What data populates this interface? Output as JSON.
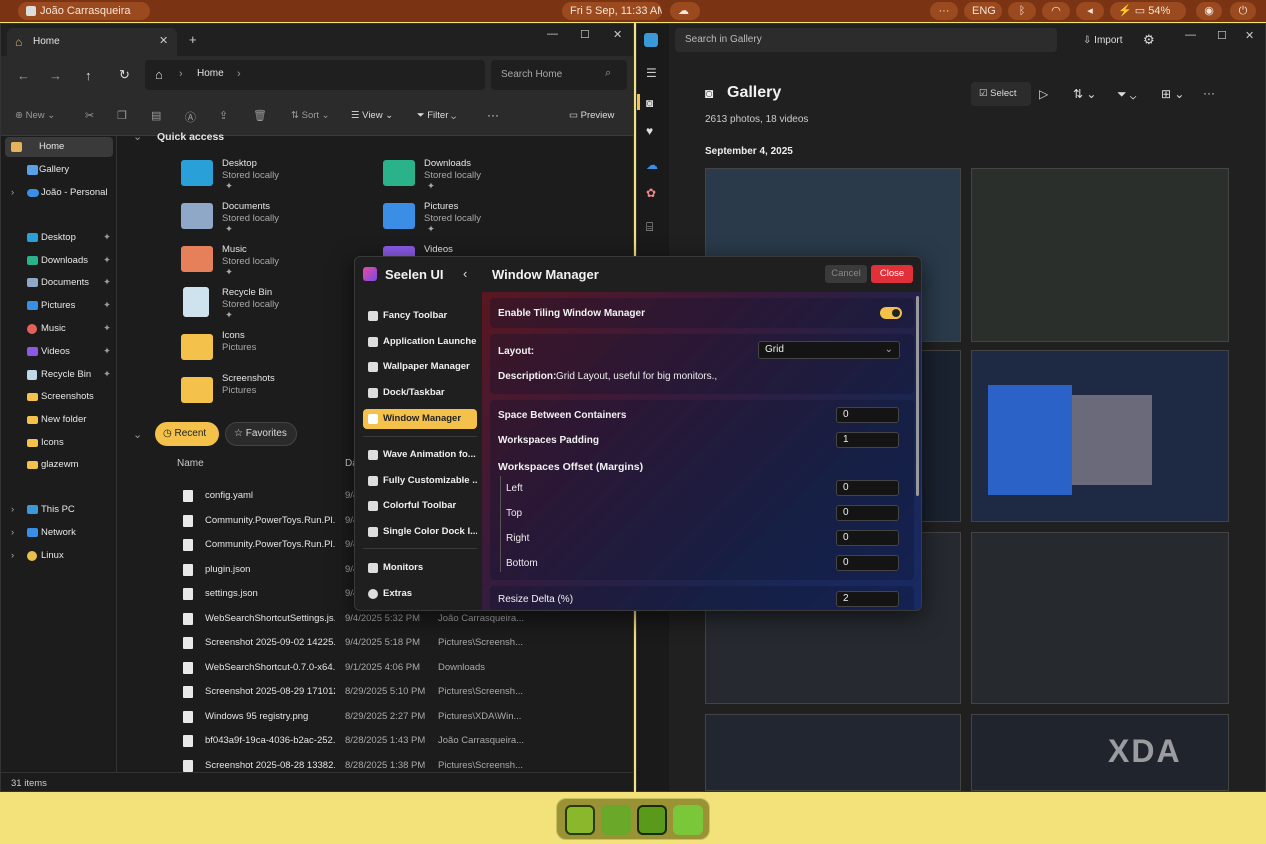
{
  "topbar": {
    "user": "João Carrasqueira",
    "datetime": "Fri 5 Sep, 11:33 AM",
    "more": "···",
    "lang": "ENG",
    "battery": "54%"
  },
  "explorer": {
    "tab_title": "Home",
    "breadcrumb": "Home",
    "search_placeholder": "Search Home",
    "cmd": {
      "new": "New",
      "sort": "Sort",
      "view": "View",
      "filter": "Filter",
      "more": "···",
      "preview": "Preview"
    },
    "sidebar": [
      {
        "label": "Home"
      },
      {
        "label": "Gallery"
      },
      {
        "label": "João - Personal"
      },
      {
        "label": "Desktop"
      },
      {
        "label": "Downloads"
      },
      {
        "label": "Documents"
      },
      {
        "label": "Pictures"
      },
      {
        "label": "Music"
      },
      {
        "label": "Videos"
      },
      {
        "label": "Recycle Bin"
      },
      {
        "label": "Screenshots"
      },
      {
        "label": "New folder"
      },
      {
        "label": "Icons"
      },
      {
        "label": "glazewm"
      },
      {
        "label": "This PC"
      },
      {
        "label": "Network"
      },
      {
        "label": "Linux"
      }
    ],
    "quick_access_title": "Quick access",
    "quick_access": [
      {
        "name": "Desktop",
        "sub": "Stored locally"
      },
      {
        "name": "Downloads",
        "sub": "Stored locally"
      },
      {
        "name": "Documents",
        "sub": "Stored locally"
      },
      {
        "name": "Pictures",
        "sub": "Stored locally"
      },
      {
        "name": "Music",
        "sub": "Stored locally"
      },
      {
        "name": "Videos",
        "sub": ""
      },
      {
        "name": "Recycle Bin",
        "sub": "Stored locally"
      },
      {
        "name": "Icons",
        "sub": "Pictures"
      },
      {
        "name": "Screenshots",
        "sub": "Pictures"
      }
    ],
    "tabs": {
      "recent": "Recent",
      "favorites": "Favorites"
    },
    "columns": {
      "name": "Name",
      "date": "Da"
    },
    "files": [
      {
        "name": "config.yaml",
        "date": "9/4",
        "loc": ""
      },
      {
        "name": "Community.PowerToys.Run.Pl...",
        "date": "9/4",
        "loc": ""
      },
      {
        "name": "Community.PowerToys.Run.Pl...",
        "date": "9/4",
        "loc": ""
      },
      {
        "name": "plugin.json",
        "date": "9/4",
        "loc": ""
      },
      {
        "name": "settings.json",
        "date": "9/4",
        "loc": ""
      },
      {
        "name": "WebSearchShortcutSettings.js...",
        "date": "9/4/2025 5:32 PM",
        "loc": "João Carrasqueira..."
      },
      {
        "name": "Screenshot 2025-09-02 14225...",
        "date": "9/4/2025 5:18 PM",
        "loc": "Pictures\\Screensh..."
      },
      {
        "name": "WebSearchShortcut-0.7.0-x64...",
        "date": "9/1/2025 4:06 PM",
        "loc": "Downloads"
      },
      {
        "name": "Screenshot 2025-08-29 171012...",
        "date": "8/29/2025 5:10 PM",
        "loc": "Pictures\\Screensh..."
      },
      {
        "name": "Windows 95 registry.png",
        "date": "8/29/2025 2:27 PM",
        "loc": "Pictures\\XDA\\Win..."
      },
      {
        "name": "bf043a9f-19ca-4036-b2ac-252...",
        "date": "8/28/2025 1:43 PM",
        "loc": "João Carrasqueira..."
      },
      {
        "name": "Screenshot 2025-08-28 13382...",
        "date": "8/28/2025 1:38 PM",
        "loc": "Pictures\\Screensh..."
      }
    ],
    "status": "31 items"
  },
  "gallery": {
    "search_placeholder": "Search in Gallery",
    "import": "Import",
    "title": "Gallery",
    "counts": "2613 photos, 18 videos",
    "select": "Select",
    "date_header": "September 4, 2025",
    "watermark": "XDA"
  },
  "seelen": {
    "app_name": "Seelen UI",
    "page_title": "Window Manager",
    "cancel": "Cancel",
    "close": "Close",
    "nav": [
      {
        "label": "Fancy Toolbar"
      },
      {
        "label": "Application Launcher"
      },
      {
        "label": "Wallpaper Manager"
      },
      {
        "label": "Dock/Taskbar"
      },
      {
        "label": "Window Manager"
      },
      {
        "label": "Wave Animation fo..."
      },
      {
        "label": "Fully Customizable ..."
      },
      {
        "label": "Colorful Toolbar"
      },
      {
        "label": "Single Color Dock I..."
      },
      {
        "label": "Monitors"
      },
      {
        "label": "Extras"
      }
    ],
    "enable_label": "Enable Tiling Window Manager",
    "enable_on": true,
    "layout_label": "Layout:",
    "layout_value": "Grid",
    "desc_label": "Description:",
    "desc_value": "Grid Layout, useful for big monitors.,",
    "space_label": "Space Between Containers",
    "space_value": "0",
    "padding_label": "Workspaces Padding",
    "padding_value": "1",
    "offset_label": "Workspaces Offset (Margins)",
    "left_label": "Left",
    "left_value": "0",
    "top_label": "Top",
    "top_value": "0",
    "right_label": "Right",
    "right_value": "0",
    "bottom_label": "Bottom",
    "bottom_value": "0",
    "resize_label": "Resize Delta (%)",
    "resize_value": "2",
    "accent": "#f4c24a",
    "close_color": "#e0303a"
  }
}
